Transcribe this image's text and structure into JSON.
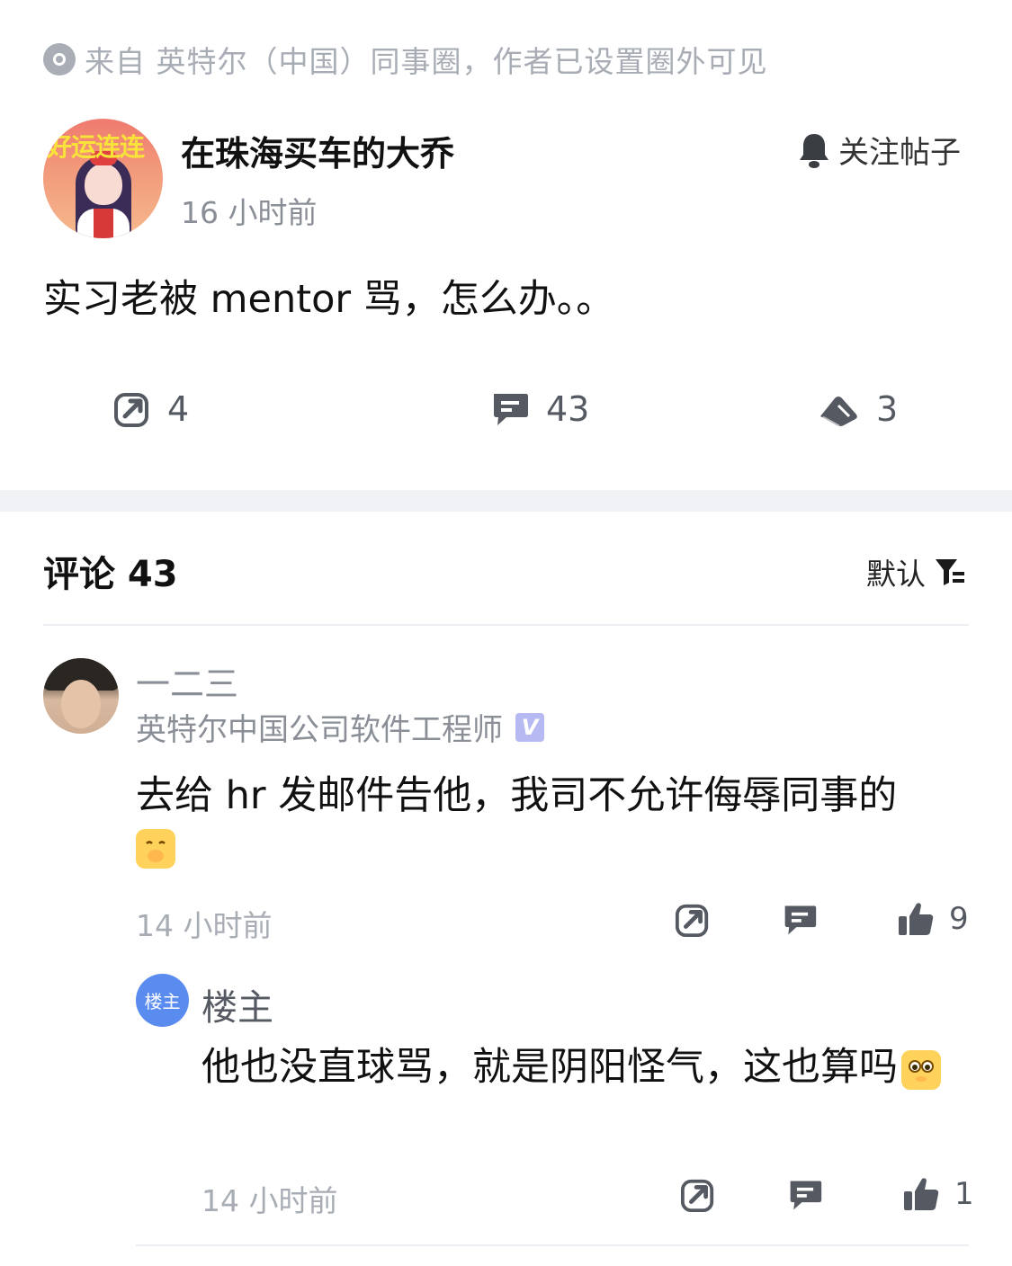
{
  "source_notice": "来自 英特尔（中国）同事圈，作者已设置圈外可见",
  "post": {
    "avatar_banner": "好运连连",
    "author_name": "在珠海买车的大乔",
    "time": "16 小时前",
    "follow_label": "关注帖子",
    "body": "实习老被 mentor 骂，怎么办。。",
    "stats": {
      "shares": "4",
      "comments": "43",
      "likes": "3"
    }
  },
  "comments_section": {
    "title": "评论 43",
    "sort_label": "默认"
  },
  "comments": [
    {
      "name": "一二三",
      "title": "英特尔中国公司软件工程师",
      "verified_badge": "V",
      "body": "去给 hr 发邮件告他，我司不允许侮辱同事的",
      "time": "14 小时前",
      "likes": "9"
    }
  ],
  "reply": {
    "avatar_label": "楼主",
    "name": "楼主",
    "body": "他也没直球骂，就是阴阳怪气，这也算吗",
    "time": "14 小时前",
    "likes": "1"
  },
  "colors": {
    "muted": "#a8adb5",
    "icon": "#555a62",
    "band": "#f1f2f5",
    "badge": "#b6b9f2",
    "reply_avatar": "#5a8cf0"
  }
}
